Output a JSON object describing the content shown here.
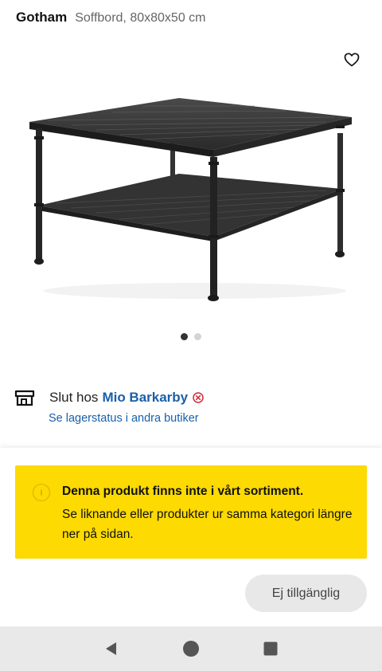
{
  "header": {
    "brand": "Gotham",
    "subtitle": "Soffbord, 80x80x50 cm"
  },
  "icons": {
    "favorite": "heart-outline-icon",
    "store": "store-icon",
    "unavailable": "circle-x-icon",
    "info": "info-icon",
    "nav_back": "triangle-back-icon",
    "nav_home": "circle-home-icon",
    "nav_recent": "square-recent-icon"
  },
  "gallery": {
    "image_count": 2,
    "active_index": 0
  },
  "store": {
    "status_prefix": "Slut hos",
    "name": "Mio Barkarby",
    "other_stores_link": "Se lagerstatus i andra butiker"
  },
  "notice": {
    "title": "Denna produkt finns inte i vårt sortiment.",
    "body": "Se liknande eller produkter ur samma kategori längre ner på sidan."
  },
  "action": {
    "unavailable_label": "Ej tillgänglig"
  },
  "colors": {
    "link": "#1a5fa8",
    "notice_bg": "#fcda02",
    "unavailable_red": "#d0283a",
    "button_bg": "#e8e8e8"
  }
}
